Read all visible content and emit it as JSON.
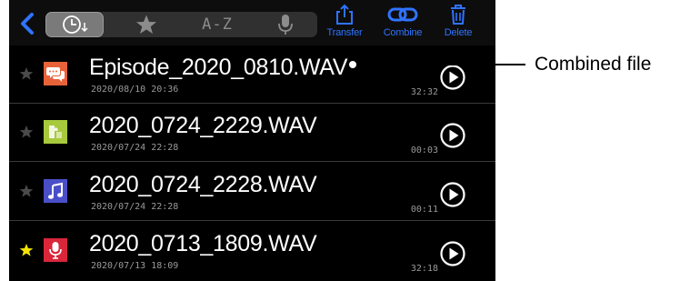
{
  "toolbar": {
    "sort_options": [
      {
        "icon": "clock-sort-icon",
        "active": true
      },
      {
        "icon": "star-icon",
        "active": false
      },
      {
        "label": "A-Z",
        "active": false
      },
      {
        "icon": "microphone-icon",
        "active": false
      }
    ],
    "actions": [
      {
        "label": "Transfer",
        "icon": "share-upload-icon"
      },
      {
        "label": "Combine",
        "icon": "link-icon"
      },
      {
        "label": "Delete",
        "icon": "trash-icon"
      }
    ]
  },
  "files": [
    {
      "name": "Episode_2020_0810.WAV",
      "date": "2020/08/10 20:36",
      "duration": "32:32",
      "starred": false,
      "icon": "speech-bubble-icon",
      "icon_color": "#e8623a"
    },
    {
      "name": "2020_0724_2229.WAV",
      "date": "2020/07/24 22:28",
      "duration": "00:03",
      "starred": false,
      "icon": "puzzle-icon",
      "icon_color": "#a7c93c"
    },
    {
      "name": "2020_0724_2228.WAV",
      "date": "2020/07/24 22:28",
      "duration": "00:11",
      "starred": false,
      "icon": "music-note-icon",
      "icon_color": "#4a4fc8"
    },
    {
      "name": "2020_0713_1809.WAV",
      "date": "2020/07/13 18:09",
      "duration": "32:18",
      "starred": true,
      "icon": "microphone-icon",
      "icon_color": "#d8263a"
    }
  ],
  "callout": {
    "label": "Combined file"
  },
  "colors": {
    "accent": "#2f73ff",
    "star_active": "#f5e400",
    "star_inactive": "#4a4a4a"
  }
}
